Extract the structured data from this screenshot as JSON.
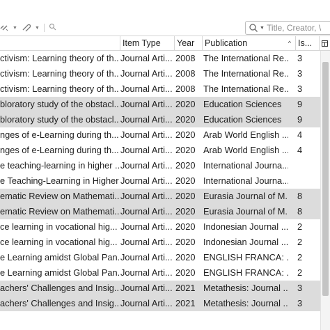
{
  "toolbar": {
    "icons": [
      "chain-link-icon",
      "paperclip-icon",
      "search-icon"
    ],
    "search_placeholder": "Title, Creator, \\"
  },
  "table": {
    "columns": [
      {
        "label": "",
        "name": "title"
      },
      {
        "label": "Item Type",
        "name": "item-type"
      },
      {
        "label": "Year",
        "name": "year"
      },
      {
        "label": "Publication",
        "name": "publication"
      },
      {
        "label": "Is...",
        "name": "is"
      }
    ],
    "rows": [
      {
        "title": "ctivism: Learning theory of th...",
        "type": "Journal Arti...",
        "year": "2008",
        "pub": "The International Re...",
        "is": "3",
        "highlight": false
      },
      {
        "title": "ctivism: Learning theory of th...",
        "type": "Journal Arti...",
        "year": "2008",
        "pub": "The International Re...",
        "is": "3",
        "highlight": false
      },
      {
        "title": "ctivism: Learning theory of th...",
        "type": "Journal Arti...",
        "year": "2008",
        "pub": "The International Re...",
        "is": "3",
        "highlight": false
      },
      {
        "title": "bloratory study of the obstacl...",
        "type": "Journal Arti...",
        "year": "2020",
        "pub": "Education Sciences",
        "is": "9",
        "highlight": true
      },
      {
        "title": "bloratory study of the obstacl...",
        "type": "Journal Arti...",
        "year": "2020",
        "pub": "Education Sciences",
        "is": "9",
        "highlight": true
      },
      {
        "title": "nges of e-Learning during th...",
        "type": "Journal Arti...",
        "year": "2020",
        "pub": "Arab World English ...",
        "is": "4",
        "highlight": false
      },
      {
        "title": "nges of e-Learning during th...",
        "type": "Journal Arti...",
        "year": "2020",
        "pub": "Arab World English ...",
        "is": "4",
        "highlight": false
      },
      {
        "title": "e teaching-learning in higher ...",
        "type": "Journal Arti...",
        "year": "2020",
        "pub": "International Journa...",
        "is": "",
        "highlight": false
      },
      {
        "title": "e Teaching-Learning in Higher ...",
        "type": "Journal Arti...",
        "year": "2020",
        "pub": "International Journa...",
        "is": "",
        "highlight": false
      },
      {
        "title": "ematic Review on Mathemati...",
        "type": "Journal Arti...",
        "year": "2020",
        "pub": "Eurasia Journal of M...",
        "is": "8",
        "highlight": true
      },
      {
        "title": "ematic Review on Mathemati...",
        "type": "Journal Arti...",
        "year": "2020",
        "pub": "Eurasia Journal of M...",
        "is": "8",
        "highlight": true
      },
      {
        "title": "ce learning in vocational hig...",
        "type": "Journal Arti...",
        "year": "2020",
        "pub": "Indonesian Journal ...",
        "is": "2",
        "highlight": false
      },
      {
        "title": "ce learning in vocational hig...",
        "type": "Journal Arti...",
        "year": "2020",
        "pub": "Indonesian Journal ...",
        "is": "2",
        "highlight": false
      },
      {
        "title": "e Learning amidst Global Pan...",
        "type": "Journal Arti...",
        "year": "2020",
        "pub": "ENGLISH FRANCA: ...",
        "is": "2",
        "highlight": false
      },
      {
        "title": "e Learning amidst Global Pan...",
        "type": "Journal Arti...",
        "year": "2020",
        "pub": "ENGLISH FRANCA: ...",
        "is": "2",
        "highlight": false
      },
      {
        "title": "achers' Challenges and Insig...",
        "type": "Journal Arti...",
        "year": "2021",
        "pub": "Metathesis: Journal ...",
        "is": "3",
        "highlight": true
      },
      {
        "title": "achers' Challenges and Insig...",
        "type": "Journal Arti...",
        "year": "2021",
        "pub": "Metathesis: Journal ...",
        "is": "3",
        "highlight": true
      }
    ]
  }
}
